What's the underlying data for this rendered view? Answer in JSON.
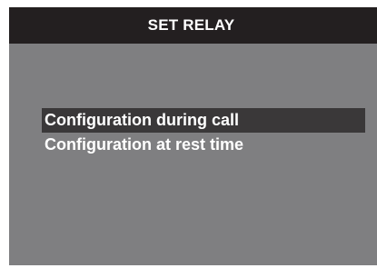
{
  "screen": {
    "title": "SET RELAY"
  },
  "menu": {
    "items": [
      {
        "label": "Configuration during call",
        "selected": true
      },
      {
        "label": "Configuration at rest time",
        "selected": false
      }
    ]
  },
  "colors": {
    "title_bar": "#231f20",
    "screen_background": "#7f7f81",
    "selection_highlight": "#3a3839",
    "text": "#ffffff"
  }
}
